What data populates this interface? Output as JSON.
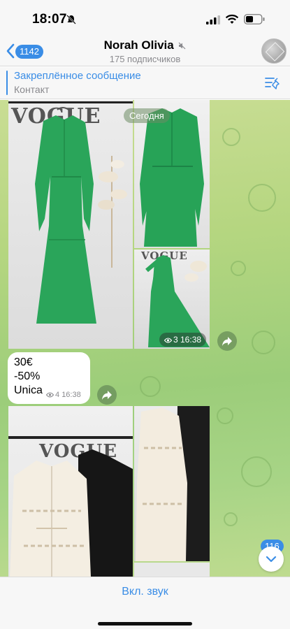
{
  "status_bar": {
    "time": "18:07"
  },
  "header": {
    "back_count": "1142",
    "channel_name": "Norah Olivia",
    "subscribers": "175 подписчиков"
  },
  "pinned": {
    "title": "Закреплённое сообщение",
    "text": "Контакт"
  },
  "chat": {
    "date_chip": "Сегодня",
    "album1": {
      "meta": "3 16:38"
    },
    "price_message": {
      "lines": [
        "30€",
        "-50%",
        "Unica"
      ],
      "views": "4",
      "time": "16:38"
    },
    "photo_brand_text": "VOGUE",
    "unread_count": "116"
  },
  "bottom": {
    "sound_label": "Вкл. звук"
  },
  "colors": {
    "accent": "#3a8de6",
    "green_dress": "#2aa55a"
  }
}
